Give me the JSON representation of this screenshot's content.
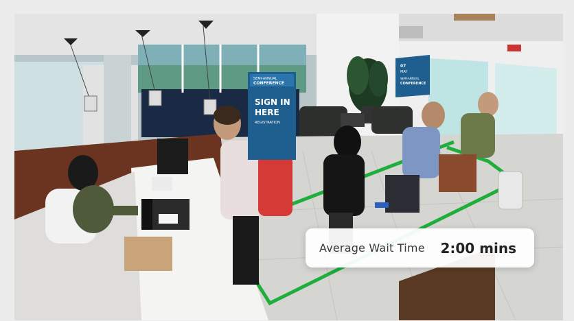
{
  "banner": {
    "small_line": "SEMI-ANNUAL",
    "heading": "CONFERENCE",
    "main_line1": "SIGN IN",
    "main_line2": "HERE",
    "sub_line": "REGISTRATION"
  },
  "wall_sign": {
    "line1": "07",
    "line2": "MAY",
    "line3": "SEMI-ANNUAL",
    "line4": "CONFERENCE"
  },
  "overlay": {
    "label": "Average Wait Time",
    "value": "2:00 mins"
  },
  "colors": {
    "floor_tape": "#1fae3b",
    "banner": "#1f5f8f",
    "backpack": "#d63a36"
  }
}
